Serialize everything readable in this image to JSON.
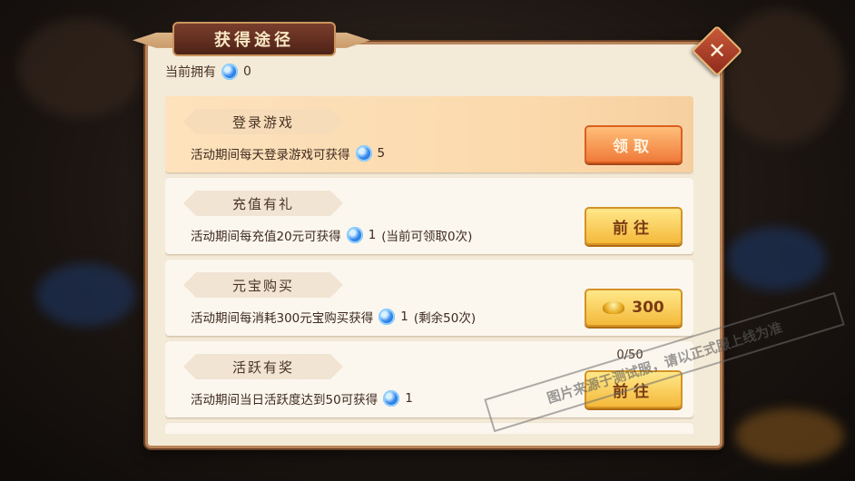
{
  "dialog": {
    "title": "获得途径",
    "owned_label": "当前拥有",
    "owned_value": "0",
    "close_label": "✕"
  },
  "rows": [
    {
      "title": "登录游戏",
      "desc": "活动期间每天登录游戏可获得",
      "amount": "5",
      "extra": "",
      "button": "领取"
    },
    {
      "title": "充值有礼",
      "desc": "活动期间每充值20元可获得",
      "amount": "1",
      "extra": "(当前可领取0次)",
      "button": "前往"
    },
    {
      "title": "元宝购买",
      "desc": "活动期间每消耗300元宝购买获得",
      "amount": "1",
      "extra": "(剩余50次)",
      "button": "300"
    },
    {
      "title": "活跃有奖",
      "desc": "活动期间当日活跃度达到50可获得",
      "amount": "1",
      "extra": "",
      "button": "前往",
      "progress": "0/50"
    }
  ],
  "icons": {
    "currency": "blue-gem-icon",
    "ingot": "gold-ingot-icon",
    "close": "close-icon"
  },
  "watermark": "图片来源于测试服，请以正式服上线为准",
  "colors": {
    "panel_bg": "#f4ead8",
    "claim_button": "#f07a3a",
    "go_button": "#f4b93a"
  }
}
